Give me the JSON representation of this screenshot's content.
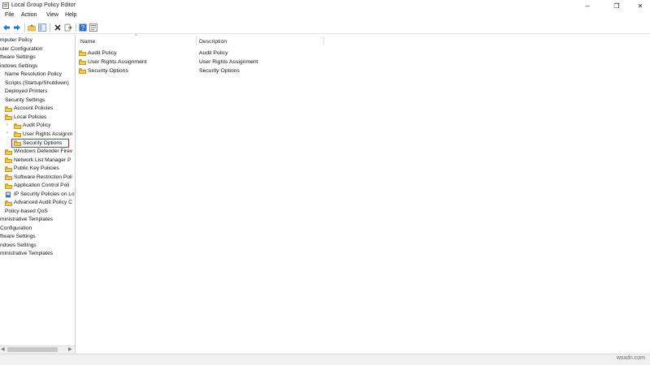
{
  "window": {
    "title": "Local Group Policy Editor",
    "minimize": "–",
    "restore": "❐",
    "close": "✕"
  },
  "menu": [
    "File",
    "Action",
    "View",
    "Help"
  ],
  "tree": [
    {
      "label": "mputer Policy"
    },
    {
      "label": "uter Configuration"
    },
    {
      "label": "ftware Settings"
    },
    {
      "label": "indows Settings"
    },
    {
      "label": "Name Resolution Policy"
    },
    {
      "label": "Scripts (Startup/Shutdown)"
    },
    {
      "label": "Deployed Printers"
    },
    {
      "label": "Security Settings"
    },
    {
      "label": "Account Policies"
    },
    {
      "label": "Local Policies"
    },
    {
      "label": "Audit Policy"
    },
    {
      "label": "User Rights Assignm"
    },
    {
      "label": "Security Options"
    },
    {
      "label": "Windows Defender Firev"
    },
    {
      "label": "Network List Manager P"
    },
    {
      "label": "Public Key Policies"
    },
    {
      "label": "Software Restriction Poli"
    },
    {
      "label": "Application Control Poli"
    },
    {
      "label": "IP Security Policies on Lo"
    },
    {
      "label": "Advanced Audit Policy C"
    },
    {
      "label": "Policy-based QoS"
    },
    {
      "label": "ministrative Templates"
    },
    {
      "label": "Configuration"
    },
    {
      "label": "ftware Settings"
    },
    {
      "label": "ndows Settings"
    },
    {
      "label": "ministrative Templates"
    }
  ],
  "list": {
    "columns": [
      "Name",
      "Description"
    ],
    "rows": [
      {
        "name": "Audit Policy",
        "description": "Audit Policy"
      },
      {
        "name": "User Rights Assignment",
        "description": "User Rights Assignment"
      },
      {
        "name": "Security Options",
        "description": "Security Options"
      }
    ]
  },
  "status": {
    "watermark": "wsxdn.com"
  },
  "colors": {
    "selection_outline": "#d9252a",
    "folder": "#f0c65a"
  }
}
